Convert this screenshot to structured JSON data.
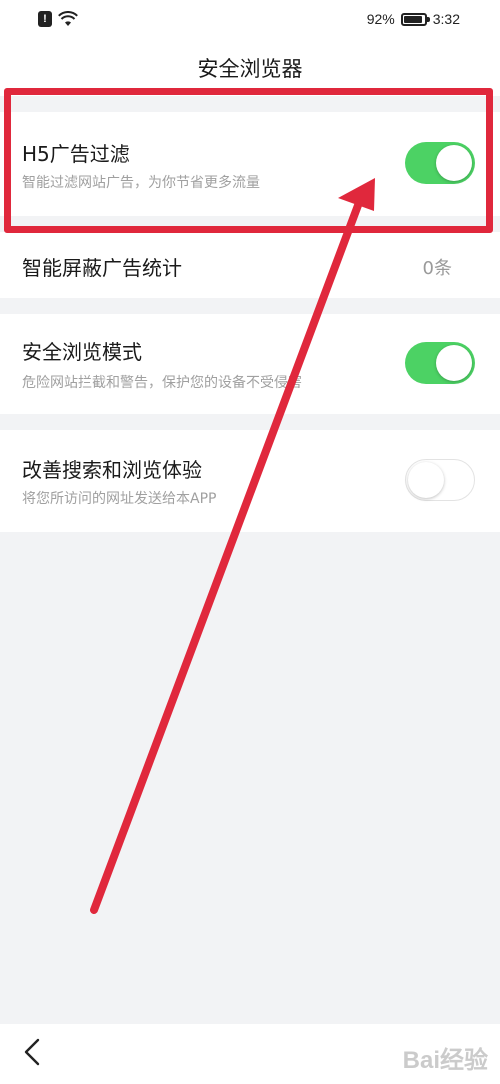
{
  "status_bar": {
    "battery": "92%",
    "battery_level": 0.92,
    "time": "3:32"
  },
  "header": {
    "title": "安全浏览器"
  },
  "settings": [
    {
      "title": "H5广告过滤",
      "subtitle": "智能过滤网站广告，为你节省更多流量",
      "toggle": "on"
    },
    {
      "title": "智能屏蔽广告统计",
      "value": "0条"
    },
    {
      "title": "安全浏览模式",
      "subtitle": "危险网站拦截和警告，保护您的设备不受侵害",
      "toggle": "on"
    },
    {
      "title": "改善搜索和浏览体验",
      "subtitle": "将您所访问的网址发送给本APP",
      "toggle": "off"
    }
  ],
  "colors": {
    "toggle_on": "#4cd264",
    "annotation_red": "#e0283c",
    "background": "#f2f3f5"
  },
  "icons": {
    "back": "chevron-left-icon",
    "alert": "alert-icon",
    "wifi": "wifi-icon",
    "battery": "battery-icon"
  },
  "watermark": "Bai经验"
}
